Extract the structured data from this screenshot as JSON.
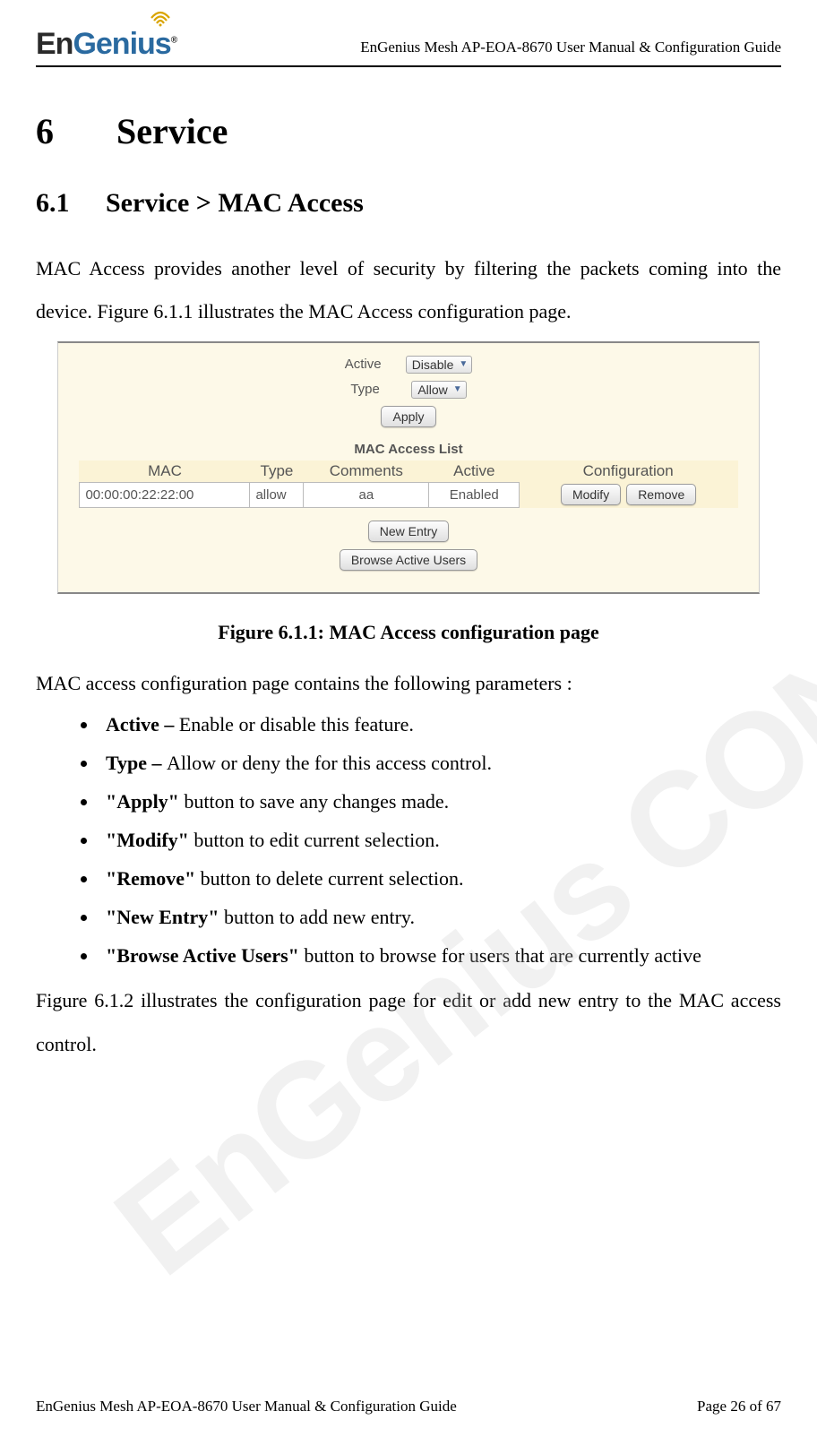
{
  "header": {
    "title": "EnGenius Mesh AP-EOA-8670 User Manual & Configuration Guide",
    "logo_text_en": "En",
    "logo_text_genius": "Genius"
  },
  "watermark": "EnGenius CONFIDENTIAL",
  "chapter": {
    "num": "6",
    "title": "Service"
  },
  "section": {
    "num": "6.1",
    "title": "Service > MAC Access"
  },
  "para1": "MAC Access provides another level of security by filtering the packets coming into the device. Figure 6.1.1 illustrates the MAC Access configuration page.",
  "figure": {
    "active_label": "Active",
    "active_value": "Disable",
    "type_label": "Type",
    "type_value": "Allow",
    "apply": "Apply",
    "list_title": "MAC Access List",
    "cols": {
      "mac": "MAC",
      "type": "Type",
      "comments": "Comments",
      "active": "Active",
      "config": "Configuration"
    },
    "row": {
      "mac": "00:00:00:22:22:00",
      "type": "allow",
      "comments": "aa",
      "active": "Enabled"
    },
    "modify": "Modify",
    "remove": "Remove",
    "new_entry": "New Entry",
    "browse": "Browse Active Users"
  },
  "caption": "Figure 6.1.1: MAC Access configuration page",
  "intro2": "MAC access configuration page contains the following parameters :",
  "bullets": {
    "b1_bold": "Active – ",
    "b1_rest": "Enable or disable this feature.",
    "b2_bold": "Type – ",
    "b2_rest": "Allow or deny the for this access control.",
    "b3_bold": "\"Apply\" ",
    "b3_rest": "button to save any changes made.",
    "b4_bold": "\"Modify\" ",
    "b4_rest": "button to edit current selection.",
    "b5_bold": "\"Remove\" ",
    "b5_rest": "button to delete current selection.",
    "b6_bold": "\"New Entry\" ",
    "b6_rest": "button to add new entry.",
    "b7_bold": "\"Browse Active Users\" ",
    "b7_rest": "button to browse for users that are currently active"
  },
  "para3": "Figure 6.1.2 illustrates the configuration page for edit or add new entry to the MAC access control.",
  "footer": {
    "left": "EnGenius Mesh AP-EOA-8670 User Manual & Configuration Guide",
    "right": "Page 26 of 67"
  }
}
